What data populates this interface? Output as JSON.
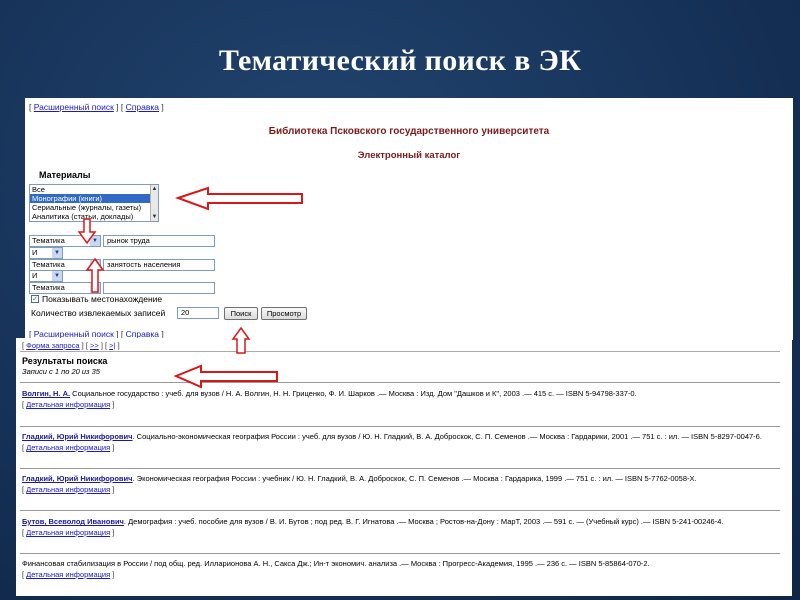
{
  "slide": {
    "title": "Тематический поиск в ЭК"
  },
  "top": {
    "nav_open": "[",
    "nav_advanced": "Расширенный поиск",
    "nav_mid": "] [",
    "nav_help": "Справка",
    "nav_close": "]",
    "library_title": "Библиотека Псковского государственного университета",
    "catalog_title": "Электронный каталог",
    "materials_label": "Материалы",
    "materials_options": [
      "Все",
      "Монографии (книги)",
      "Сериальные (журналы, газеты)",
      "Аналитика (статьи, доклады)"
    ],
    "materials_selected": "Монографии (книги)",
    "row1_field": "Тематика",
    "row1_value": "рынок труда",
    "op1": "И",
    "row2_field": "Тематика",
    "row2_value": "занятость населения",
    "op2": "И",
    "row3_field": "Тематика",
    "show_location_label": "Показывать местонахождение",
    "show_location_checked": true,
    "records_label": "Количество извлекаемых записей",
    "records_value": "20",
    "search_button": "Поиск",
    "browse_button": "Просмотр"
  },
  "results": {
    "nav": "[ Форма запроса ] [ >> ] [ >| ]",
    "nav_form": "Форма запроса",
    "nav_next": ">>",
    "nav_last": ">|",
    "title": "Результаты поиска",
    "count": "Записи с 1 по 20 из 35",
    "detail_label": "Детальная информация",
    "records": [
      {
        "author": "Волгин, Н. А.",
        "text": " Социальное государство : учеб. для вузов / Н. А. Волгин, Н. Н. Гриценко, Ф. И. Шарков .— Москва : Изд. Дом \"Дашков и К\", 2003 .— 415 с. — ISBN 5-94798-337-0."
      },
      {
        "author": "Гладкий, Юрий Никифорович",
        "text": ". Социально-экономическая география России : учеб. для вузов / Ю. Н. Гладкий, В. А. Доброскок, С. П. Семенов .— Москва : Гардарики, 2001 .— 751 с. : ил. — ISBN 5-8297-0047-6."
      },
      {
        "author": "Гладкий, Юрий Никифорович",
        "text": ". Экономическая география России : учебник / Ю. Н. Гладкий, В. А. Доброскок, С. П. Семенов .— Москва : Гардарика, 1999 .— 751 с. : ил. — ISBN 5-7762-0058-Х."
      },
      {
        "author": "Бутов, Всеволод Иванович",
        "text": ". Демография : учеб. пособие для вузов / В. И. Бутов ; под ред. В. Г. Игнатова .— Москва ; Ростов-на-Дону : МарТ, 2003 .— 591 с. — (Учебный курс) .— ISBN 5-241-00246-4."
      },
      {
        "author": "",
        "text": "Финансовая стабилизация в России / под общ. ред. Илларионова А. Н., Сакса Дж.; Ин-т экономич. анализа .— Москва : Прогресс-Академия, 1995 .— 236 с. — ISBN 5-85864-070-2."
      }
    ]
  },
  "colors": {
    "background": "#17335a",
    "arrow": "#d81818",
    "link": "#1a1acc",
    "heading_red": "#7a1a1a"
  }
}
